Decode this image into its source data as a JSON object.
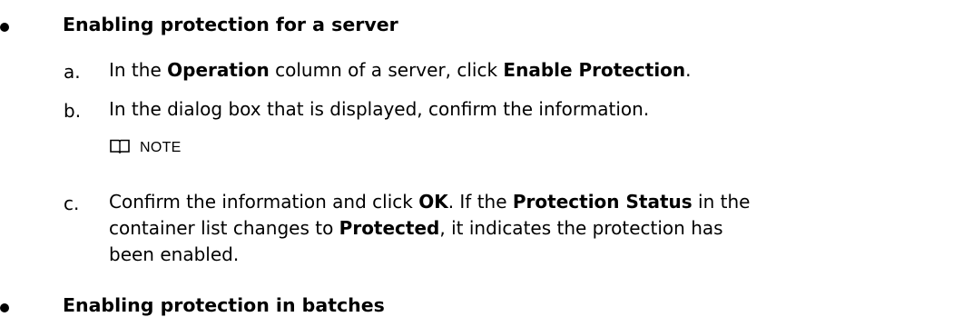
{
  "sections": [
    {
      "title": "Enabling protection for a server"
    },
    {
      "title": "Enabling protection in batches"
    }
  ],
  "steps": [
    {
      "letter": "a.",
      "parts": [
        {
          "text": "In the ",
          "bold": false
        },
        {
          "text": "Operation",
          "bold": true
        },
        {
          "text": " column of a server, click ",
          "bold": false
        },
        {
          "text": "Enable Protection",
          "bold": true
        },
        {
          "text": ".",
          "bold": false
        }
      ]
    },
    {
      "letter": "b.",
      "parts": [
        {
          "text": "In the dialog box that is displayed, confirm the information.",
          "bold": false
        }
      ]
    },
    {
      "letter": "c.",
      "parts": [
        {
          "text": "Confirm the information and click ",
          "bold": false
        },
        {
          "text": "OK",
          "bold": true
        },
        {
          "text": ". If the ",
          "bold": false
        },
        {
          "text": "Protection Status",
          "bold": true
        },
        {
          "text": " in the container list changes to ",
          "bold": false
        },
        {
          "text": "Protected",
          "bold": true
        },
        {
          "text": ", it indicates the protection has been enabled.",
          "bold": false
        }
      ]
    }
  ],
  "note": {
    "label": "NOTE",
    "icon": "book-icon"
  }
}
